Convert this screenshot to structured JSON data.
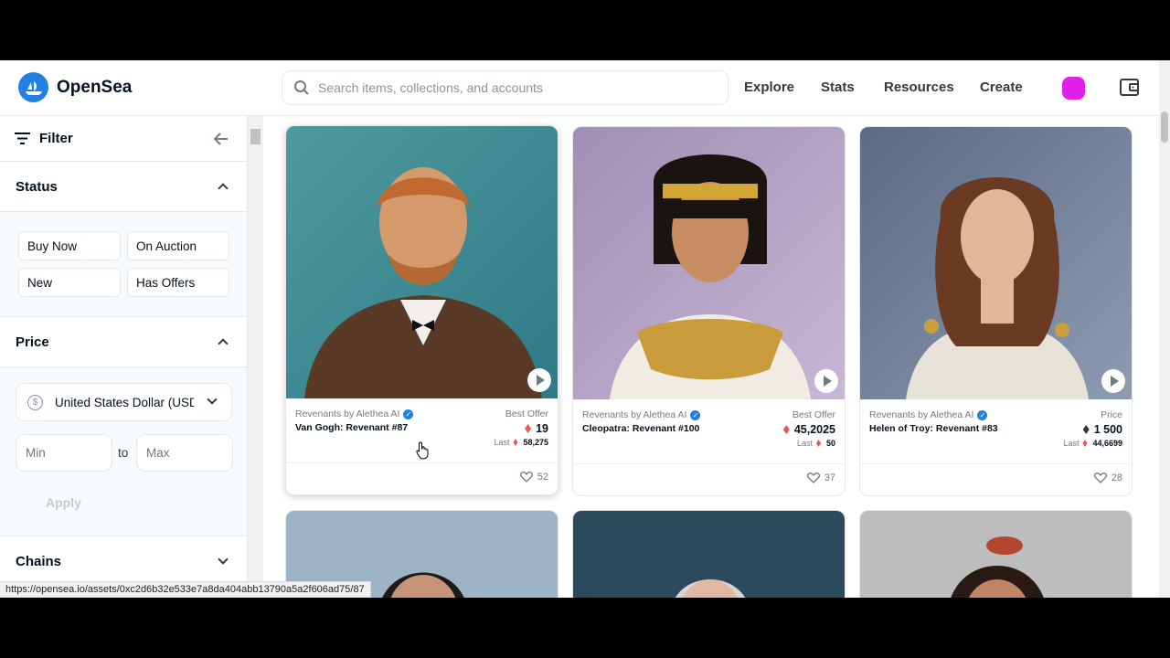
{
  "brand": {
    "name": "OpenSea",
    "accent": "#2081e2"
  },
  "search": {
    "placeholder": "Search items, collections, and accounts"
  },
  "nav": {
    "explore": "Explore",
    "stats": "Stats",
    "resources": "Resources",
    "create": "Create"
  },
  "sidebar": {
    "filter_label": "Filter",
    "status": {
      "title": "Status",
      "options": [
        "Buy Now",
        "On Auction",
        "New",
        "Has Offers"
      ]
    },
    "price": {
      "title": "Price",
      "currency": "United States Dollar (USD)",
      "currency_symbol": "$",
      "min_placeholder": "Min",
      "max_placeholder": "Max",
      "to_label": "to",
      "apply_label": "Apply"
    },
    "chains": {
      "title": "Chains"
    }
  },
  "items": [
    {
      "collection": "Revenants by Alethea AI",
      "name": "Van Gogh: Revenant #87",
      "price_label": "Best Offer",
      "price": "19",
      "last_label": "Last",
      "last": "58,275",
      "likes": "52"
    },
    {
      "collection": "Revenants by Alethea AI",
      "name": "Cleopatra: Revenant #100",
      "price_label": "Best Offer",
      "price": "45,2025",
      "last_label": "Last",
      "last": "50",
      "likes": "37"
    },
    {
      "collection": "Revenants by Alethea AI",
      "name": "Helen of Troy: Revenant #83",
      "price_label": "Price",
      "price": "1 500",
      "last_label": "Last",
      "last": "44,6699",
      "likes": "28"
    }
  ],
  "status_bar": {
    "url": "https://opensea.io/assets/0xc2d6b32e533e7a8da404abb13790a5a2f606ad75/87"
  }
}
